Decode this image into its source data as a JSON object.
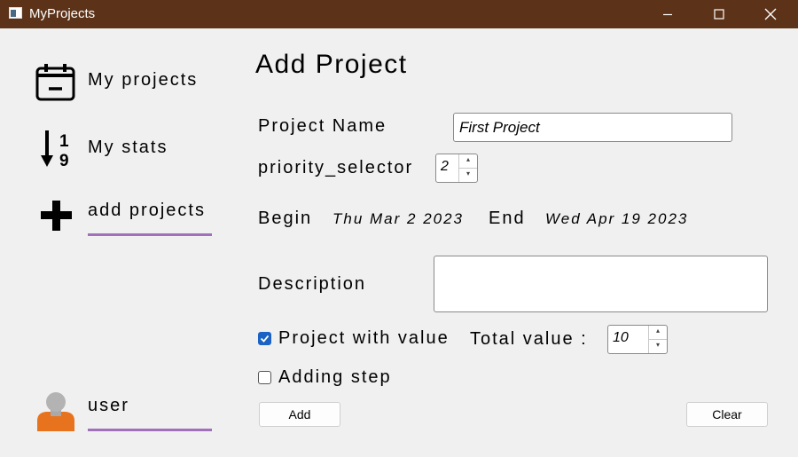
{
  "window": {
    "title": "MyProjects"
  },
  "sidebar": {
    "items": [
      {
        "label": "My projects",
        "icon": "calendar-icon"
      },
      {
        "label": "My stats",
        "icon": "sort-numeric-icon"
      },
      {
        "label": "add projects",
        "icon": "plus-icon",
        "active": true
      }
    ],
    "user": {
      "label": "user",
      "icon": "user-avatar-icon"
    },
    "accent_color": "#a070b8"
  },
  "form": {
    "heading": "Add Project",
    "project_name": {
      "label": "Project Name",
      "value": "First Project"
    },
    "priority": {
      "label": "priority_selector",
      "value": "2"
    },
    "begin": {
      "label": "Begin",
      "value": "Thu Mar 2 2023"
    },
    "end": {
      "label": "End",
      "value": "Wed Apr 19 2023"
    },
    "description": {
      "label": "Description",
      "value": ""
    },
    "with_value": {
      "label": "Project with value",
      "checked": true
    },
    "total_value": {
      "label": "Total value :",
      "value": "10"
    },
    "adding_step": {
      "label": "Adding step",
      "checked": false
    },
    "add_button": "Add",
    "clear_button": "Clear"
  },
  "colors": {
    "titlebar": "#5c3319",
    "checkbox_checked": "#1a63c4"
  }
}
